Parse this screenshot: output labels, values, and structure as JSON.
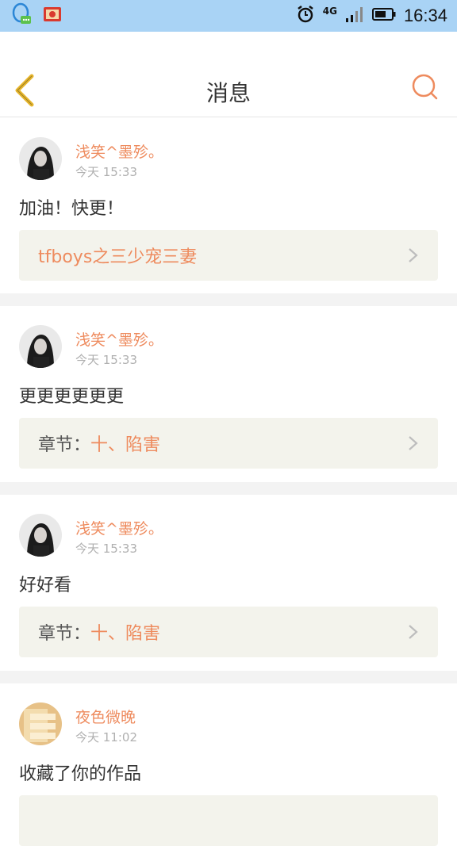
{
  "status_bar": {
    "network": "4G",
    "time": "16:34",
    "icons": [
      "qq-icon",
      "app-icon",
      "alarm-icon",
      "signal-icon",
      "battery-icon"
    ]
  },
  "header": {
    "title": "消息",
    "back_icon": "chevron-left-icon",
    "search_icon": "search-icon"
  },
  "colors": {
    "accent": "#ee8b5e",
    "back_arrow": "#e7b62d",
    "link_bg": "#f3f3ec",
    "status_bar": "#a9d3f5"
  },
  "messages": [
    {
      "name": "浅笑^墨殄。",
      "time": "今天 15:33",
      "content": "加油！快更！",
      "link_prefix": "",
      "link_target": "tfboys之三少宠三妻"
    },
    {
      "name": "浅笑^墨殄。",
      "time": "今天 15:33",
      "content": "更更更更更更",
      "link_prefix": "章节：",
      "link_target": "十、陷害"
    },
    {
      "name": "浅笑^墨殄。",
      "time": "今天 15:33",
      "content": "好好看",
      "link_prefix": "章节：",
      "link_target": "十、陷害"
    },
    {
      "name": "夜色微晚",
      "time": "今天 11:02",
      "content": "收藏了你的作品",
      "link_prefix": "",
      "link_target": ""
    }
  ]
}
